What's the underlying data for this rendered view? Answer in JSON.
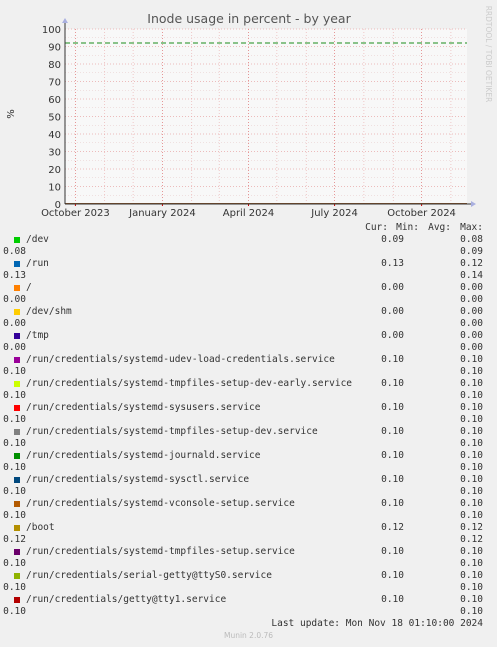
{
  "chart_data": {
    "type": "line",
    "title": "Inode usage in percent - by year",
    "ylabel": "%",
    "xlabel": "",
    "ylim": [
      0,
      100
    ],
    "yticks": [
      0,
      10,
      20,
      30,
      40,
      50,
      60,
      70,
      80,
      90,
      100
    ],
    "xticks": [
      "October 2023",
      "January 2024",
      "April 2024",
      "July 2024",
      "October 2024"
    ],
    "xrange": [
      "2023-09-20",
      "2024-11-18"
    ],
    "xtick_dates": [
      "2023-10-01",
      "2024-01-01",
      "2024-04-01",
      "2024-07-01",
      "2024-10-01"
    ],
    "warning_level": 92,
    "grid": true,
    "side_label": "RRDTOOL / TOBI OETIKER",
    "series": [
      {
        "name": "/dev",
        "color": "#00cc00",
        "cur": "0.09",
        "min": "0.08",
        "avg": "0.08",
        "max": "0.09"
      },
      {
        "name": "/run",
        "color": "#0066b3",
        "cur": "0.13",
        "min": "0.12",
        "avg": "0.13",
        "max": "0.14"
      },
      {
        "name": "/",
        "color": "#ff8000",
        "cur": "0.00",
        "min": "0.00",
        "avg": "0.00",
        "max": "0.00"
      },
      {
        "name": "/dev/shm",
        "color": "#ffcc00",
        "cur": "0.00",
        "min": "0.00",
        "avg": "0.00",
        "max": "0.00"
      },
      {
        "name": "/tmp",
        "color": "#330099",
        "cur": "0.00",
        "min": "0.00",
        "avg": "0.00",
        "max": "0.00"
      },
      {
        "name": "/run/credentials/systemd-udev-load-credentials.service",
        "color": "#990099",
        "cur": "0.10",
        "min": "0.10",
        "avg": "0.10",
        "max": "0.10"
      },
      {
        "name": "/run/credentials/systemd-tmpfiles-setup-dev-early.service",
        "color": "#ccff00",
        "cur": "0.10",
        "min": "0.10",
        "avg": "0.10",
        "max": "0.10"
      },
      {
        "name": "/run/credentials/systemd-sysusers.service",
        "color": "#ff0000",
        "cur": "0.10",
        "min": "0.10",
        "avg": "0.10",
        "max": "0.10"
      },
      {
        "name": "/run/credentials/systemd-tmpfiles-setup-dev.service",
        "color": "#808080",
        "cur": "0.10",
        "min": "0.10",
        "avg": "0.10",
        "max": "0.10"
      },
      {
        "name": "/run/credentials/systemd-journald.service",
        "color": "#008f00",
        "cur": "0.10",
        "min": "0.10",
        "avg": "0.10",
        "max": "0.10"
      },
      {
        "name": "/run/credentials/systemd-sysctl.service",
        "color": "#00487d",
        "cur": "0.10",
        "min": "0.10",
        "avg": "0.10",
        "max": "0.10"
      },
      {
        "name": "/run/credentials/systemd-vconsole-setup.service",
        "color": "#b35a00",
        "cur": "0.10",
        "min": "0.10",
        "avg": "0.10",
        "max": "0.10"
      },
      {
        "name": "/boot",
        "color": "#b38f00",
        "cur": "0.12",
        "min": "0.12",
        "avg": "0.12",
        "max": "0.12"
      },
      {
        "name": "/run/credentials/systemd-tmpfiles-setup.service",
        "color": "#6b006b",
        "cur": "0.10",
        "min": "0.10",
        "avg": "0.10",
        "max": "0.10"
      },
      {
        "name": "/run/credentials/serial-getty@ttyS0.service",
        "color": "#8fb300",
        "cur": "0.10",
        "min": "0.10",
        "avg": "0.10",
        "max": "0.10"
      },
      {
        "name": "/run/credentials/getty@tty1.service",
        "color": "#b30000",
        "cur": "0.10",
        "min": "0.10",
        "avg": "0.10",
        "max": "0.10"
      }
    ]
  },
  "legend_header": {
    "cur": "Cur:",
    "min": "Min:",
    "avg": "Avg:",
    "max": "Max:"
  },
  "last_update": "Last update: Mon Nov 18 01:10:00 2024",
  "footer": "Munin 2.0.76"
}
